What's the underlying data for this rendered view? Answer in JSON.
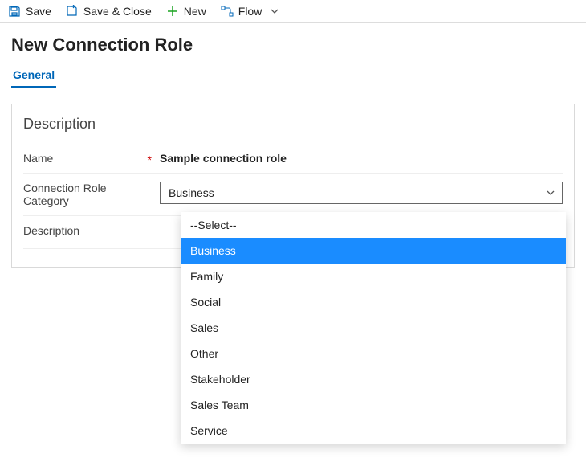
{
  "toolbar": {
    "save": "Save",
    "save_close": "Save & Close",
    "new": "New",
    "flow": "Flow"
  },
  "page_title": "New Connection Role",
  "tabs": {
    "general": "General"
  },
  "section": {
    "title": "Description",
    "name_label": "Name",
    "name_value": "Sample connection role",
    "category_label": "Connection Role Category",
    "category_value": "Business",
    "description_label": "Description"
  },
  "dropdown": {
    "options": [
      "--Select--",
      "Business",
      "Family",
      "Social",
      "Sales",
      "Other",
      "Stakeholder",
      "Sales Team",
      "Service"
    ],
    "highlight_index": 1
  }
}
